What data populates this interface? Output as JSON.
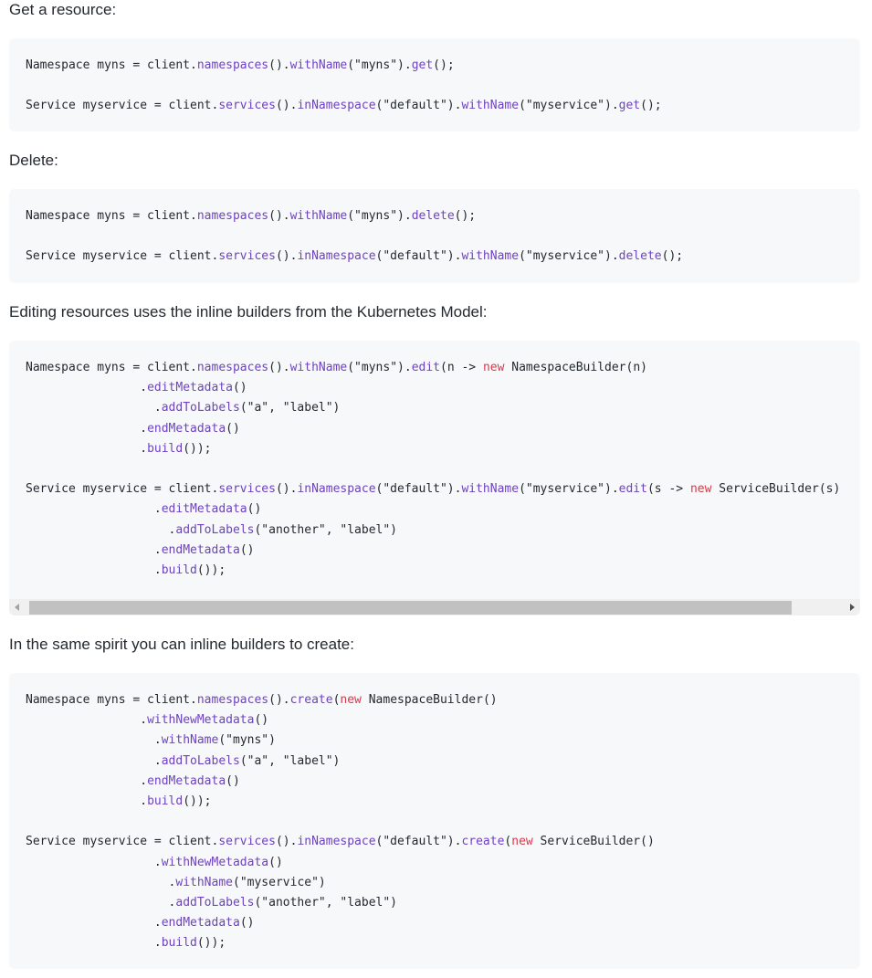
{
  "paragraphs": {
    "get": "Get a resource:",
    "delete": "Delete:",
    "edit": "Editing resources uses the inline builders from the Kubernetes Model:",
    "create": "In the same spirit you can inline builders to create:"
  },
  "code_blocks": [
    {
      "name": "get-code-block",
      "lines": [
        [
          [
            "Namespace myns = client.",
            "p"
          ],
          [
            "namespaces",
            "m"
          ],
          [
            "().",
            "p"
          ],
          [
            "withName",
            "m"
          ],
          [
            "(\"myns\").",
            "p"
          ],
          [
            "get",
            "m"
          ],
          [
            "();",
            "p"
          ]
        ],
        [],
        [
          [
            "Service myservice = client.",
            "p"
          ],
          [
            "services",
            "m"
          ],
          [
            "().",
            "p"
          ],
          [
            "inNamespace",
            "m"
          ],
          [
            "(\"default\").",
            "p"
          ],
          [
            "withName",
            "m"
          ],
          [
            "(\"myservice\").",
            "p"
          ],
          [
            "get",
            "m"
          ],
          [
            "();",
            "p"
          ]
        ]
      ]
    },
    {
      "name": "delete-code-block",
      "lines": [
        [
          [
            "Namespace myns = client.",
            "p"
          ],
          [
            "namespaces",
            "m"
          ],
          [
            "().",
            "p"
          ],
          [
            "withName",
            "m"
          ],
          [
            "(\"myns\").",
            "p"
          ],
          [
            "delete",
            "m"
          ],
          [
            "();",
            "p"
          ]
        ],
        [],
        [
          [
            "Service myservice = client.",
            "p"
          ],
          [
            "services",
            "m"
          ],
          [
            "().",
            "p"
          ],
          [
            "inNamespace",
            "m"
          ],
          [
            "(\"default\").",
            "p"
          ],
          [
            "withName",
            "m"
          ],
          [
            "(\"myservice\").",
            "p"
          ],
          [
            "delete",
            "m"
          ],
          [
            "();",
            "p"
          ]
        ]
      ]
    },
    {
      "name": "edit-code-block",
      "lines": [
        [
          [
            "Namespace myns = client.",
            "p"
          ],
          [
            "namespaces",
            "m"
          ],
          [
            "().",
            "p"
          ],
          [
            "withName",
            "m"
          ],
          [
            "(\"myns\").",
            "p"
          ],
          [
            "edit",
            "m"
          ],
          [
            "(n -> ",
            "p"
          ],
          [
            "new",
            "k"
          ],
          [
            " NamespaceBuilder(n)",
            "p"
          ]
        ],
        [
          [
            "                .",
            "p"
          ],
          [
            "editMetadata",
            "m"
          ],
          [
            "()",
            "p"
          ]
        ],
        [
          [
            "                  .",
            "p"
          ],
          [
            "addToLabels",
            "m"
          ],
          [
            "(\"a\", \"label\")",
            "p"
          ]
        ],
        [
          [
            "                .",
            "p"
          ],
          [
            "endMetadata",
            "m"
          ],
          [
            "()",
            "p"
          ]
        ],
        [
          [
            "                .",
            "p"
          ],
          [
            "build",
            "m"
          ],
          [
            "());",
            "p"
          ]
        ],
        [],
        [
          [
            "Service myservice = client.",
            "p"
          ],
          [
            "services",
            "m"
          ],
          [
            "().",
            "p"
          ],
          [
            "inNamespace",
            "m"
          ],
          [
            "(\"default\").",
            "p"
          ],
          [
            "withName",
            "m"
          ],
          [
            "(\"myservice\").",
            "p"
          ],
          [
            "edit",
            "m"
          ],
          [
            "(s -> ",
            "p"
          ],
          [
            "new",
            "k"
          ],
          [
            " ServiceBuilder(s)",
            "p"
          ]
        ],
        [
          [
            "                  .",
            "p"
          ],
          [
            "editMetadata",
            "m"
          ],
          [
            "()",
            "p"
          ]
        ],
        [
          [
            "                    .",
            "p"
          ],
          [
            "addToLabels",
            "m"
          ],
          [
            "(\"another\", \"label\")",
            "p"
          ]
        ],
        [
          [
            "                  .",
            "p"
          ],
          [
            "endMetadata",
            "m"
          ],
          [
            "()",
            "p"
          ]
        ],
        [
          [
            "                  .",
            "p"
          ],
          [
            "build",
            "m"
          ],
          [
            "());",
            "p"
          ]
        ]
      ]
    },
    {
      "name": "create-code-block",
      "lines": [
        [
          [
            "Namespace myns = client.",
            "p"
          ],
          [
            "namespaces",
            "m"
          ],
          [
            "().",
            "p"
          ],
          [
            "create",
            "m"
          ],
          [
            "(",
            "p"
          ],
          [
            "new",
            "k"
          ],
          [
            " NamespaceBuilder()",
            "p"
          ]
        ],
        [
          [
            "                .",
            "p"
          ],
          [
            "withNewMetadata",
            "m"
          ],
          [
            "()",
            "p"
          ]
        ],
        [
          [
            "                  .",
            "p"
          ],
          [
            "withName",
            "m"
          ],
          [
            "(\"myns\")",
            "p"
          ]
        ],
        [
          [
            "                  .",
            "p"
          ],
          [
            "addToLabels",
            "m"
          ],
          [
            "(\"a\", \"label\")",
            "p"
          ]
        ],
        [
          [
            "                .",
            "p"
          ],
          [
            "endMetadata",
            "m"
          ],
          [
            "()",
            "p"
          ]
        ],
        [
          [
            "                .",
            "p"
          ],
          [
            "build",
            "m"
          ],
          [
            "());",
            "p"
          ]
        ],
        [],
        [
          [
            "Service myservice = client.",
            "p"
          ],
          [
            "services",
            "m"
          ],
          [
            "().",
            "p"
          ],
          [
            "inNamespace",
            "m"
          ],
          [
            "(\"default\").",
            "p"
          ],
          [
            "create",
            "m"
          ],
          [
            "(",
            "p"
          ],
          [
            "new",
            "k"
          ],
          [
            " ServiceBuilder()",
            "p"
          ]
        ],
        [
          [
            "                  .",
            "p"
          ],
          [
            "withNewMetadata",
            "m"
          ],
          [
            "()",
            "p"
          ]
        ],
        [
          [
            "                    .",
            "p"
          ],
          [
            "withName",
            "m"
          ],
          [
            "(\"myservice\")",
            "p"
          ]
        ],
        [
          [
            "                    .",
            "p"
          ],
          [
            "addToLabels",
            "m"
          ],
          [
            "(\"another\", \"label\")",
            "p"
          ]
        ],
        [
          [
            "                  .",
            "p"
          ],
          [
            "endMetadata",
            "m"
          ],
          [
            "()",
            "p"
          ]
        ],
        [
          [
            "                  .",
            "p"
          ],
          [
            "build",
            "m"
          ],
          [
            "());",
            "p"
          ]
        ]
      ]
    }
  ],
  "edit_scrollbar": {
    "scroll_position": 0,
    "left_arrow_icon": "triangle-left-icon",
    "right_arrow_icon": "triangle-right-icon"
  },
  "colors": {
    "method": "#6f42c1",
    "keyword": "#d73a49",
    "plain": "#24292f",
    "code_background": "#f6f8fa"
  }
}
